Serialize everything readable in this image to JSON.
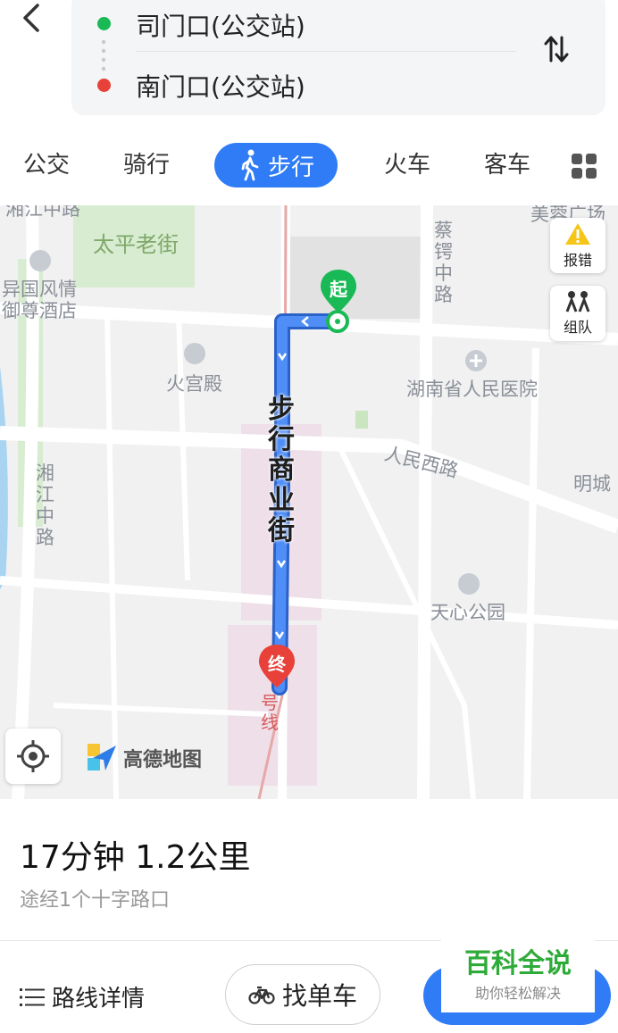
{
  "route": {
    "origin": "司门口(公交站)",
    "destination": "南门口(公交站)"
  },
  "tabs": [
    {
      "label": "公交"
    },
    {
      "label": "骑行"
    },
    {
      "label": "步行",
      "active": true
    },
    {
      "label": "火车"
    },
    {
      "label": "客车"
    }
  ],
  "map": {
    "labels": {
      "taiping": "太平老街",
      "yiguo1": "异国风情",
      "yiguo2": "御尊酒店",
      "huogong": "火宫殿",
      "caie_road": "蔡锷中路",
      "hospital": "湖南省人民医院",
      "renmin_road": "人民西路",
      "mingcheng": "明城",
      "xiangjiang_road": "湘江中路",
      "tianxin_park": "天心公园",
      "street": "步行商业街",
      "metro_line": "号线",
      "top_left_clip": "湘江中路",
      "top_right_clip": "美蓉广场"
    },
    "buttons": {
      "report": "报错",
      "group": "组队"
    },
    "start_marker": "起",
    "end_marker": "终",
    "brand": "高德地图"
  },
  "summary": {
    "duration_distance": "17分钟  1.2公里",
    "via": "途经1个十字路口"
  },
  "bottom": {
    "details": "路线详情",
    "bike": "找单车"
  },
  "watermark": {
    "title": "百科全说",
    "subtitle": "助你轻松解决"
  },
  "colors": {
    "accent": "#2f7cf6",
    "route": "#3d7ef0",
    "start": "#19b955",
    "end": "#e8413a",
    "watermark": "#2fab3a"
  }
}
